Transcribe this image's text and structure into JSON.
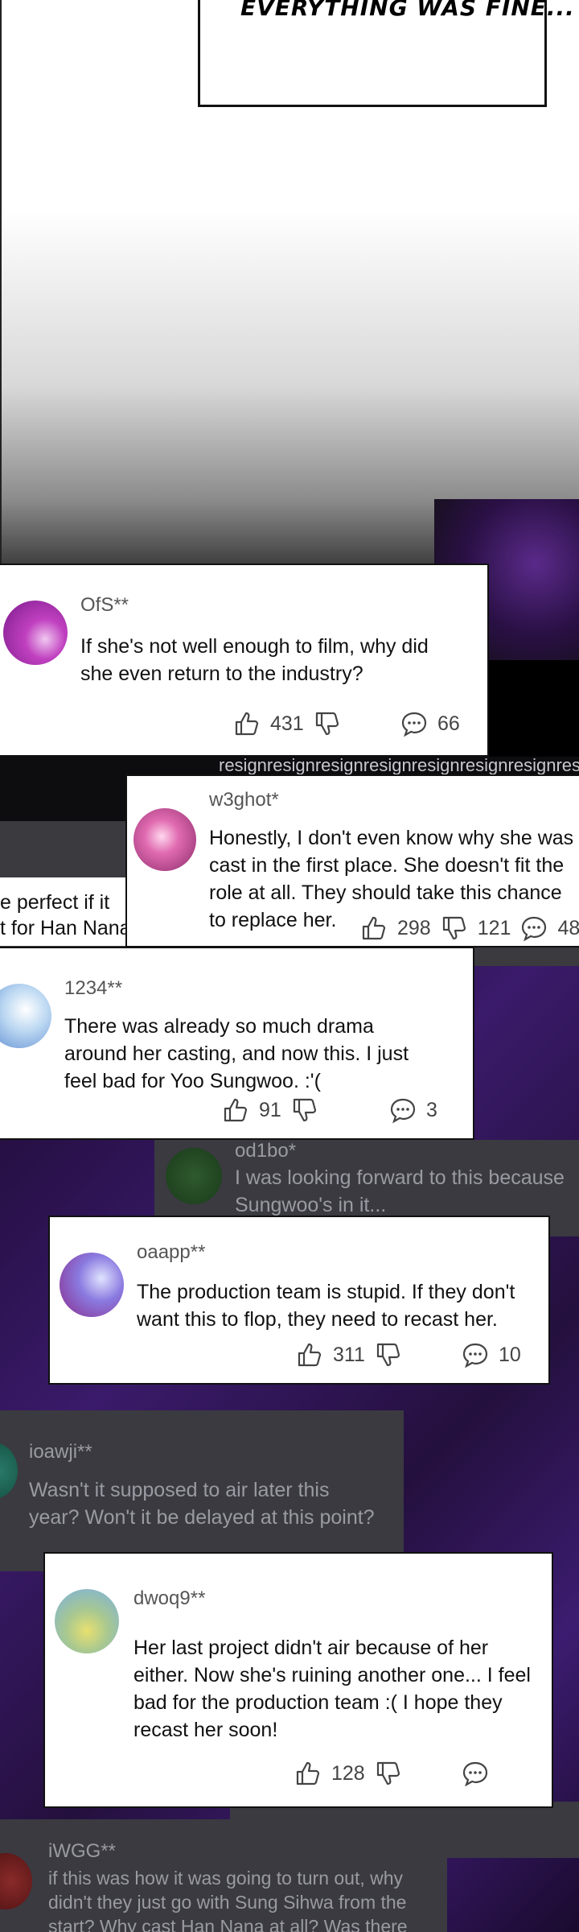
{
  "panel": {
    "caption": "EVERYTHING WAS FINE..."
  },
  "background_text": {
    "resign": "resignresignresignresignresignresignresignresignres",
    "scrap_line1": "e perfect if it",
    "scrap_line2": "t for Han Nana."
  },
  "comments": [
    {
      "user": "OfS**",
      "text": "If she's not well enough to film, why did she even return to the industry?",
      "likes": "431",
      "dislikes": "",
      "replies": "66"
    },
    {
      "user": "w3ghot*",
      "text": "Honestly, I don't even know why she was cast in the first place. She doesn't fit the role at all. They should take this chance to replace her.",
      "likes": "298",
      "dislikes": "121",
      "replies": "48"
    },
    {
      "user": "1234**",
      "text": "There was already so much drama around her casting, and now this. I just feel bad for Yoo Sungwoo. :'(",
      "likes": "91",
      "dislikes": "",
      "replies": "3"
    },
    {
      "user": "od1bo*",
      "text": "I was looking forward to this because Sungwoo's in it...",
      "likes": "",
      "dislikes": "",
      "replies": ""
    },
    {
      "user": "oaapp**",
      "text": "The production team is stupid. If they don't want this to flop, they need to recast her.",
      "likes": "311",
      "dislikes": "",
      "replies": "10"
    },
    {
      "user": "ioawji**",
      "text": "Wasn't it supposed to air later this year? Won't it be delayed at this point?",
      "likes": "",
      "dislikes": "",
      "replies": ""
    },
    {
      "user": "dwoq9**",
      "text": "Her last project didn't air because of her either. Now she's ruining another one... I feel bad for the production team :( I hope they recast her soon!",
      "likes": "128",
      "dislikes": "",
      "replies": ""
    },
    {
      "user": "iWGG**",
      "text": "if this was how it was going to turn out, why didn't they just go with Sung Sihwa from the start? Why cast Han Nana at all? Was there",
      "likes": "",
      "dislikes": "",
      "replies": ""
    }
  ],
  "icons": {
    "like": "thumbs-up-icon",
    "dislike": "thumbs-down-icon",
    "reply": "speech-bubble-icon"
  },
  "colors": {
    "purple_bg": "#2a1045",
    "card_border": "#111111"
  }
}
